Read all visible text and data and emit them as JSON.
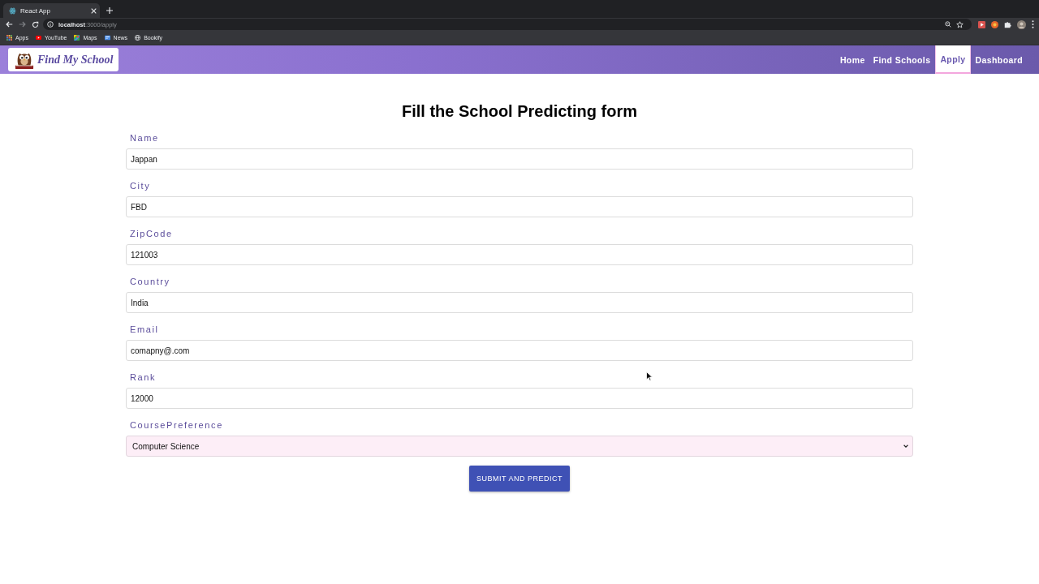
{
  "browser": {
    "tabs": [
      {
        "title": "React App",
        "selected": true
      }
    ],
    "address": {
      "host": "localhost",
      "path": ":3000/apply"
    },
    "bookmarks": [
      "Apps",
      "YouTube",
      "Maps",
      "News",
      "Bookify"
    ]
  },
  "navbar": {
    "logo_text": "Find My School",
    "links": [
      {
        "label": "Home",
        "selected": false
      },
      {
        "label": "Find Schools",
        "selected": false
      },
      {
        "label": "Apply",
        "selected": true
      },
      {
        "label": "Dashboard",
        "selected": false
      }
    ]
  },
  "form": {
    "title": "Fill the School Predicting form",
    "fields": [
      {
        "kind": "text",
        "label": "Name",
        "value": "Jappan"
      },
      {
        "kind": "text",
        "label": "City",
        "value": "FBD"
      },
      {
        "kind": "text",
        "label": "ZipCode",
        "value": "121003"
      },
      {
        "kind": "text",
        "label": "Country",
        "value": "India"
      },
      {
        "kind": "text",
        "label": "Email",
        "value": "comapny@.com"
      },
      {
        "kind": "text",
        "label": "Rank",
        "value": "12000"
      },
      {
        "kind": "select",
        "label": "CoursePreference",
        "value": "Computer Science"
      }
    ],
    "submit": "SUBMIT AND PREDICT"
  }
}
